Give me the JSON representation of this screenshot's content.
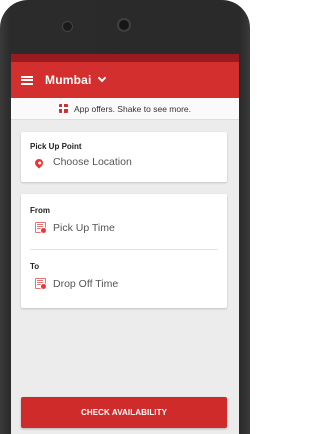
{
  "header": {
    "city": "Mumbai"
  },
  "offers": {
    "text": "App offers. Shake to see more."
  },
  "pickup": {
    "label": "Pick Up Point",
    "value": "Choose Location"
  },
  "from": {
    "label": "From",
    "value": "Pick Up Time"
  },
  "to": {
    "label": "To",
    "value": "Drop Off Time"
  },
  "cta": {
    "label": "CHECK AVAILABILITY"
  },
  "colors": {
    "primary": "#d32f2f",
    "statusbar": "#9a1a1f",
    "background": "#ececec"
  }
}
